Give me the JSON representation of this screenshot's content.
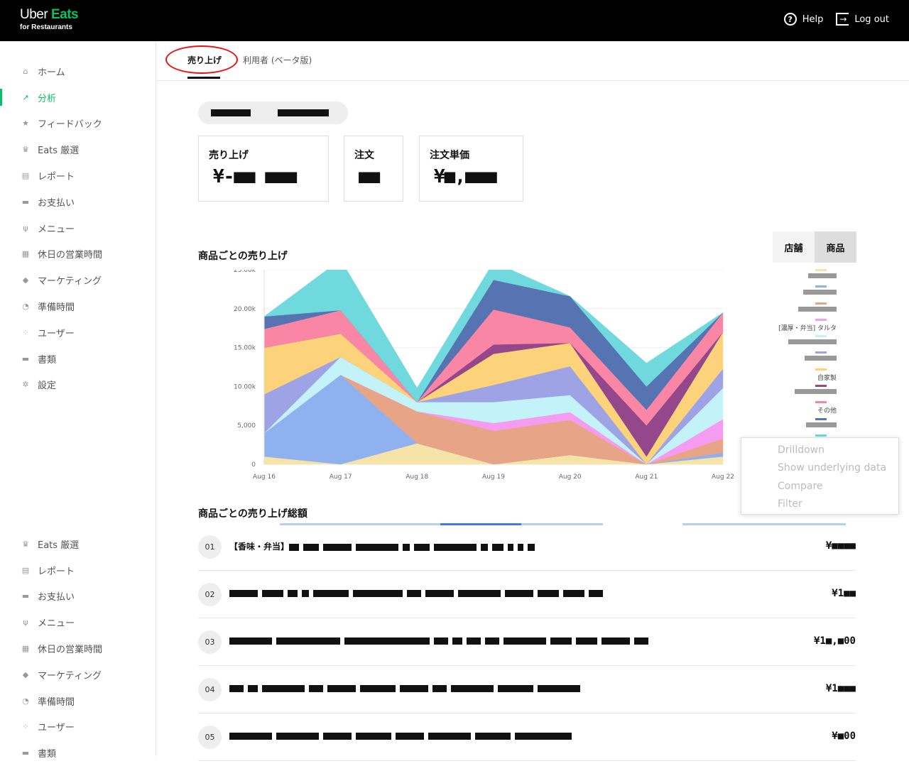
{
  "header": {
    "logo_line1_a": "Uber",
    "logo_line1_b": "Eats",
    "logo_line2": "for Restaurants",
    "help": "Help",
    "logout": "Log out"
  },
  "sidebar": {
    "items": [
      {
        "label": "ホーム",
        "icon": "home-icon",
        "glyph": "⌂"
      },
      {
        "label": "分析",
        "icon": "chart-icon",
        "glyph": "↗"
      },
      {
        "label": "フィードバック",
        "icon": "star-icon",
        "glyph": "★"
      },
      {
        "label": "Eats 厳選",
        "icon": "award-icon",
        "glyph": "♛"
      },
      {
        "label": "レポート",
        "icon": "report-icon",
        "glyph": "▤"
      },
      {
        "label": "お支払い",
        "icon": "card-icon",
        "glyph": "▬"
      },
      {
        "label": "メニュー",
        "icon": "utensils-icon",
        "glyph": "ψ"
      },
      {
        "label": "休日の営業時間",
        "icon": "calendar-icon",
        "glyph": "▦"
      },
      {
        "label": "マーケティング",
        "icon": "tag-icon",
        "glyph": "◆"
      },
      {
        "label": "準備時間",
        "icon": "timer-icon",
        "glyph": "◔"
      },
      {
        "label": "ユーザー",
        "icon": "users-icon",
        "glyph": "⁘"
      },
      {
        "label": "書類",
        "icon": "folder-icon",
        "glyph": "▬"
      },
      {
        "label": "設定",
        "icon": "gear-icon",
        "glyph": "✲"
      }
    ],
    "items_lower": [
      {
        "label": "Eats 厳選",
        "icon": "award-icon",
        "glyph": "♛"
      },
      {
        "label": "レポート",
        "icon": "report-icon",
        "glyph": "▤"
      },
      {
        "label": "お支払い",
        "icon": "card-icon",
        "glyph": "▬"
      },
      {
        "label": "メニュー",
        "icon": "utensils-icon",
        "glyph": "ψ"
      },
      {
        "label": "休日の営業時間",
        "icon": "calendar-icon",
        "glyph": "▦"
      },
      {
        "label": "マーケティング",
        "icon": "tag-icon",
        "glyph": "◆"
      },
      {
        "label": "準備時間",
        "icon": "timer-icon",
        "glyph": "◔"
      },
      {
        "label": "ユーザー",
        "icon": "users-icon",
        "glyph": "⁘"
      },
      {
        "label": "書類",
        "icon": "folder-icon",
        "glyph": "▬"
      }
    ]
  },
  "tabs": {
    "sales": "売り上げ",
    "users": "利用者 (ベータ版)"
  },
  "kpis": [
    {
      "title": "売り上げ",
      "value": "¥-■■ ■■■"
    },
    {
      "title": "注文",
      "value": "■■"
    },
    {
      "title": "注文単価",
      "value": "¥■,■■■"
    }
  ],
  "chart_section": {
    "title": "商品ごとの売り上げ",
    "toggle": [
      "店舗",
      "商品"
    ]
  },
  "chart_data": {
    "type": "area",
    "stacked": true,
    "x": [
      "Aug 16",
      "Aug 17",
      "Aug 18",
      "Aug 19",
      "Aug 20",
      "Aug 21",
      "Aug 22"
    ],
    "ylim": [
      0,
      25000
    ],
    "yticks": [
      "0",
      "5,000",
      "10.00k",
      "15.00k",
      "20.00k",
      "25.00k"
    ],
    "grid": true,
    "legend_position": "right",
    "series": [
      {
        "color": "#f6e3a8",
        "values": [
          1000,
          0,
          2700,
          0,
          1200,
          0,
          1000
        ]
      },
      {
        "color": "#8fb1f0",
        "values": [
          3000,
          11500,
          0,
          0,
          0,
          0,
          500
        ]
      },
      {
        "color": "#e8a486",
        "values": [
          0,
          0,
          4100,
          4300,
          4500,
          0,
          1800
        ]
      },
      {
        "color": "#f59cf0",
        "values": [
          0,
          0,
          0,
          1000,
          1000,
          0,
          2500
        ]
      },
      {
        "color": "#c3f2f9",
        "values": [
          0,
          2300,
          1200,
          2700,
          2200,
          0,
          4000
        ]
      },
      {
        "color": "#9ea3e5",
        "values": [
          5000,
          0,
          0,
          2200,
          3700,
          0,
          2500
        ]
      },
      {
        "color": "#fcd27b",
        "values": [
          6000,
          3000,
          0,
          4000,
          3000,
          1000,
          4700
        ]
      },
      {
        "color": "#94478a",
        "values": [
          0,
          0,
          0,
          1200,
          0,
          4000,
          0
        ]
      },
      {
        "color": "#fa86a6",
        "values": [
          2400,
          3000,
          0,
          4500,
          2000,
          2000,
          2500
        ]
      },
      {
        "color": "#5673b2",
        "values": [
          1600,
          0,
          0,
          3800,
          4000,
          3000,
          0
        ]
      },
      {
        "color": "#6fd9dd",
        "values": [
          0,
          6500,
          1800,
          2300,
          0,
          3000,
          0
        ]
      }
    ]
  },
  "legend": {
    "visible_text": [
      "[濃厚・弁当] タルタ",
      "自家製",
      "その他"
    ]
  },
  "context_menu": [
    "Drilldown",
    "Show underlying data",
    "Compare",
    "Filter"
  ],
  "list": {
    "title": "商品ごとの売り上げ総額",
    "rows": [
      {
        "rank": "01",
        "prefix": "【香味・弁当】",
        "amount": "¥■■■■"
      },
      {
        "rank": "02",
        "prefix": "",
        "amount": "¥1■■"
      },
      {
        "rank": "03",
        "prefix": "",
        "amount": "¥1■,■00"
      },
      {
        "rank": "04",
        "prefix": "",
        "amount": "¥1■■■"
      },
      {
        "rank": "05",
        "prefix": "",
        "amount": "¥■00"
      }
    ]
  }
}
